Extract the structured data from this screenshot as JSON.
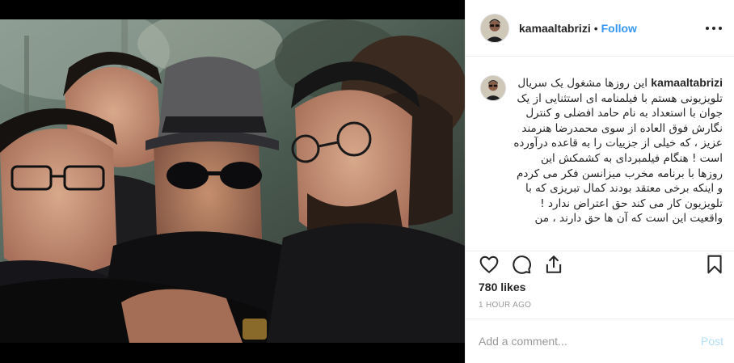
{
  "post": {
    "username": "kamaaltabrizi",
    "follow_separator": "•",
    "follow_label": "Follow",
    "more_icon": "more-options-icon",
    "photo_alt": "Group selfie of five men outdoors",
    "caption": {
      "username": "kamaaltabrizi",
      "text": "این روزها مشغول یک سریال تلویزیونی هستم با فیلمنامه ای استثنایی از یک جوان با استعداد به نام حامد افضلی و کنترل نگارش فوق العاده از سوی محمدرضا هنرمند عزیز ، که خیلی از جزییات را به قاعده درآورده است ! هنگام فیلمبردای به کشمکش این روزها با برنامه مخرب میزانسن فکر می کردم و اینکه برخی معتقد بودند کمال تبریزی که با تلویزیون کار می کند حق اعتراض ندارد ! واقعیت این است که آن ها حق دارند ، من"
    },
    "actions": {
      "like_icon": "heart-icon",
      "comment_icon": "comment-icon",
      "share_icon": "share-icon",
      "save_icon": "bookmark-icon"
    },
    "likes_label": "780 likes",
    "timestamp": "1 HOUR AGO",
    "comment_placeholder": "Add a comment...",
    "post_button": "Post",
    "colors": {
      "link": "#3897f0",
      "post_disabled": "#b2dffc",
      "muted": "#999999",
      "border": "#efefef"
    }
  }
}
